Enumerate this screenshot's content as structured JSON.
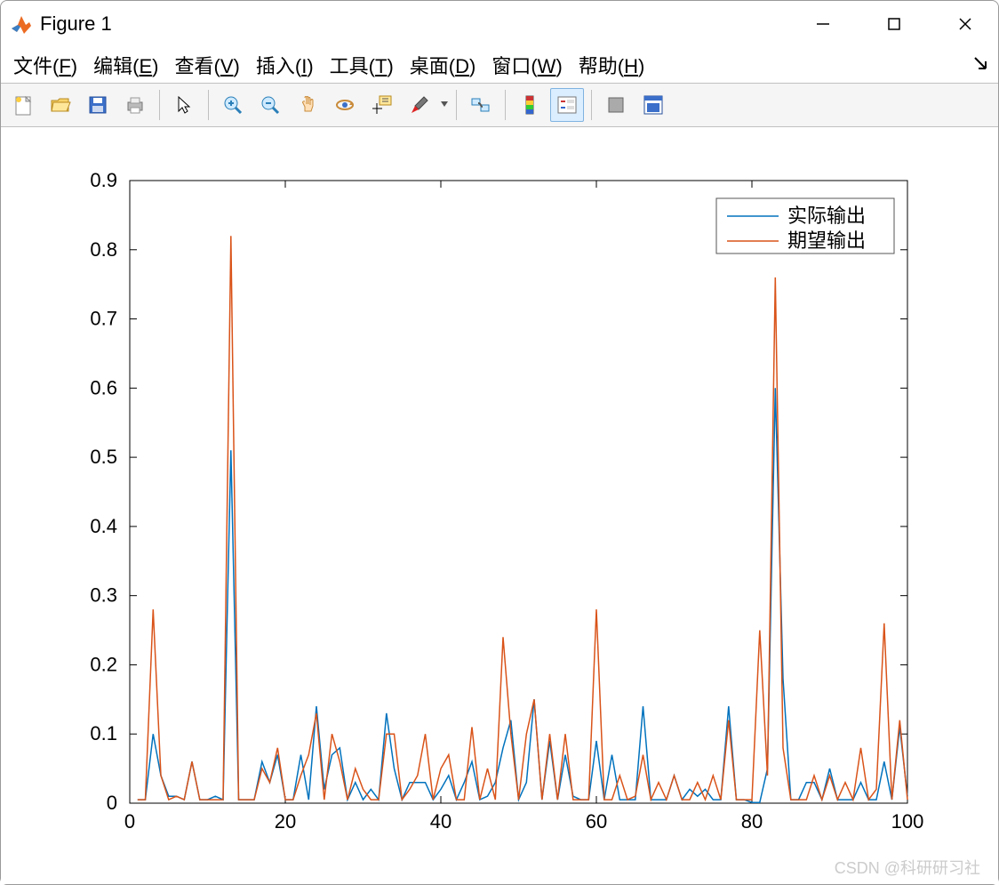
{
  "window": {
    "title": "Figure 1"
  },
  "menu": {
    "file": {
      "label": "文件",
      "key": "F"
    },
    "edit": {
      "label": "编辑",
      "key": "E"
    },
    "view": {
      "label": "查看",
      "key": "V"
    },
    "insert": {
      "label": "插入",
      "key": "I"
    },
    "tools": {
      "label": "工具",
      "key": "T"
    },
    "desktop": {
      "label": "桌面",
      "key": "D"
    },
    "window": {
      "label": "窗口",
      "key": "W"
    },
    "help": {
      "label": "帮助",
      "key": "H"
    }
  },
  "toolbar": {
    "new": "new-figure",
    "open": "open",
    "save": "save",
    "print": "print",
    "pointer": "pointer",
    "zoom_in": "zoom-in",
    "zoom_out": "zoom-out",
    "pan": "pan",
    "rotate": "rotate-3d",
    "data_cursor": "data-cursor",
    "brush": "brush",
    "link": "link",
    "colorbar": "insert-colorbar",
    "legend": "insert-legend",
    "hide": "hide-tools",
    "dock": "dock-figure"
  },
  "watermark": "CSDN @科研研习社",
  "chart_data": {
    "type": "line",
    "xlabel": "",
    "ylabel": "",
    "xlim": [
      0,
      100
    ],
    "ylim": [
      0,
      0.9
    ],
    "xticks": [
      0,
      20,
      40,
      60,
      80,
      100
    ],
    "yticks": [
      0,
      0.1,
      0.2,
      0.3,
      0.4,
      0.5,
      0.6,
      0.7,
      0.8,
      0.9
    ],
    "legend": {
      "position": "top-right",
      "entries": [
        "实际输出",
        "期望输出"
      ]
    },
    "colors": {
      "actual": "#0072BD",
      "expected": "#D95319"
    },
    "x": [
      1,
      2,
      3,
      4,
      5,
      6,
      7,
      8,
      9,
      10,
      11,
      12,
      13,
      14,
      15,
      16,
      17,
      18,
      19,
      20,
      21,
      22,
      23,
      24,
      25,
      26,
      27,
      28,
      29,
      30,
      31,
      32,
      33,
      34,
      35,
      36,
      37,
      38,
      39,
      40,
      41,
      42,
      43,
      44,
      45,
      46,
      47,
      48,
      49,
      50,
      51,
      52,
      53,
      54,
      55,
      56,
      57,
      58,
      59,
      60,
      61,
      62,
      63,
      64,
      65,
      66,
      67,
      68,
      69,
      70,
      71,
      72,
      73,
      74,
      75,
      76,
      77,
      78,
      79,
      80,
      81,
      82,
      83,
      84,
      85,
      86,
      87,
      88,
      89,
      90,
      91,
      92,
      93,
      94,
      95,
      96,
      97,
      98,
      99,
      100
    ],
    "series": [
      {
        "name": "实际输出",
        "color": "#0072BD",
        "values": [
          0.005,
          0.005,
          0.1,
          0.04,
          0.01,
          0.01,
          0.005,
          0.06,
          0.005,
          0.005,
          0.01,
          0.005,
          0.51,
          0.005,
          0.005,
          0.005,
          0.06,
          0.03,
          0.07,
          0.005,
          0.005,
          0.07,
          0.005,
          0.14,
          0.02,
          0.07,
          0.08,
          0.005,
          0.03,
          0.005,
          0.02,
          0.005,
          0.13,
          0.05,
          0.005,
          0.03,
          0.03,
          0.03,
          0.005,
          0.02,
          0.04,
          0.005,
          0.03,
          0.06,
          0.005,
          0.01,
          0.03,
          0.08,
          0.12,
          0.005,
          0.03,
          0.15,
          0.005,
          0.09,
          0.005,
          0.07,
          0.01,
          0.005,
          0.005,
          0.09,
          0.005,
          0.07,
          0.005,
          0.005,
          0.005,
          0.14,
          0.005,
          0.005,
          0.005,
          0.04,
          0.005,
          0.02,
          0.01,
          0.02,
          0.005,
          0.005,
          0.14,
          0.005,
          0.005,
          0.001,
          0.001,
          0.05,
          0.6,
          0.18,
          0.005,
          0.005,
          0.03,
          0.03,
          0.005,
          0.05,
          0.005,
          0.005,
          0.005,
          0.03,
          0.005,
          0.005,
          0.06,
          0.005,
          0.11,
          0.01
        ]
      },
      {
        "name": "期望输出",
        "color": "#D95319",
        "values": [
          0.005,
          0.005,
          0.28,
          0.04,
          0.005,
          0.01,
          0.005,
          0.06,
          0.005,
          0.005,
          0.005,
          0.005,
          0.82,
          0.005,
          0.005,
          0.005,
          0.05,
          0.03,
          0.08,
          0.005,
          0.005,
          0.04,
          0.07,
          0.13,
          0.005,
          0.1,
          0.06,
          0.005,
          0.05,
          0.02,
          0.005,
          0.005,
          0.1,
          0.1,
          0.005,
          0.02,
          0.04,
          0.1,
          0.005,
          0.05,
          0.07,
          0.005,
          0.005,
          0.11,
          0.005,
          0.05,
          0.005,
          0.24,
          0.1,
          0.005,
          0.1,
          0.15,
          0.005,
          0.1,
          0.005,
          0.1,
          0.005,
          0.005,
          0.005,
          0.28,
          0.005,
          0.005,
          0.04,
          0.005,
          0.01,
          0.07,
          0.005,
          0.03,
          0.005,
          0.04,
          0.005,
          0.005,
          0.03,
          0.005,
          0.04,
          0.005,
          0.12,
          0.005,
          0.005,
          0.005,
          0.25,
          0.04,
          0.76,
          0.08,
          0.005,
          0.005,
          0.005,
          0.04,
          0.005,
          0.04,
          0.005,
          0.03,
          0.005,
          0.08,
          0.005,
          0.02,
          0.26,
          0.005,
          0.12,
          0.005
        ]
      }
    ]
  }
}
